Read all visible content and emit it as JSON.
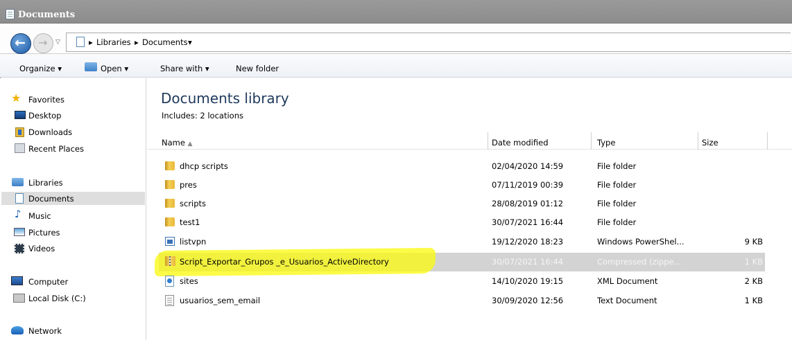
{
  "window": {
    "title": "Documents"
  },
  "address": {
    "crumbs": [
      "Libraries",
      "Documents"
    ]
  },
  "toolbar": {
    "organize": "Organize",
    "open": "Open",
    "share_with": "Share with",
    "new_folder": "New folder"
  },
  "nav": {
    "favorites": "Favorites",
    "favorites_items": [
      "Desktop",
      "Downloads",
      "Recent Places"
    ],
    "libraries": "Libraries",
    "library_items": [
      "Documents",
      "Music",
      "Pictures",
      "Videos"
    ],
    "selected": "Documents",
    "computer": "Computer",
    "computer_items": [
      "Local Disk (C:)"
    ],
    "network": "Network"
  },
  "library": {
    "title": "Documents library",
    "includes_label": "Includes:",
    "includes_link": "2 locations"
  },
  "columns": {
    "name": "Name",
    "date": "Date modified",
    "type": "Type",
    "size": "Size"
  },
  "files": [
    {
      "name": "dhcp scripts",
      "date": "02/04/2020 14:59",
      "type": "File folder",
      "size": "",
      "icon": "folder-icon"
    },
    {
      "name": "pres",
      "date": "07/11/2019 00:39",
      "type": "File folder",
      "size": "",
      "icon": "folder-icon"
    },
    {
      "name": "scripts",
      "date": "28/08/2019 01:12",
      "type": "File folder",
      "size": "",
      "icon": "folder-icon"
    },
    {
      "name": "test1",
      "date": "30/07/2021 16:44",
      "type": "File folder",
      "size": "",
      "icon": "folder-icon"
    },
    {
      "name": "listvpn",
      "date": "19/12/2020 18:23",
      "type": "Windows PowerShel...",
      "size": "9 KB",
      "icon": "powershell-script-icon"
    },
    {
      "name": "Script_Exportar_Grupos _e_Usuarios_ActiveDirectory",
      "date": "30/07/2021 16:44",
      "type": "Compressed (zippe...",
      "size": "1 KB",
      "icon": "zip-folder-icon",
      "selected": true
    },
    {
      "name": "sites",
      "date": "14/10/2020 19:15",
      "type": "XML Document",
      "size": "2 KB",
      "icon": "xml-document-icon"
    },
    {
      "name": "usuarios_sem_email",
      "date": "30/09/2020 12:56",
      "type": "Text Document",
      "size": "1 KB",
      "icon": "text-document-icon"
    }
  ]
}
